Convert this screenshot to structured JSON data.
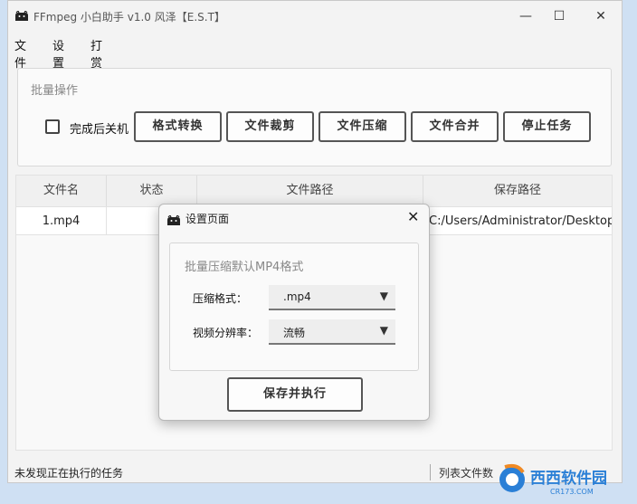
{
  "window": {
    "title": "FFmpeg 小白助手 v1.0 风泽【E.S.T】",
    "minimize": "—",
    "maximize": "☐",
    "close": "✕"
  },
  "menu": [
    "文件",
    "设置",
    "打赏"
  ],
  "batch": {
    "title": "批量操作",
    "shutdown_label": "完成后关机",
    "shutdown_checked": false,
    "buttons": [
      "格式转换",
      "文件裁剪",
      "文件压缩",
      "文件合并",
      "停止任务"
    ]
  },
  "table": {
    "headers": [
      "文件名",
      "状态",
      "文件路径",
      "保存路径"
    ],
    "rows": [
      [
        "1.mp4",
        "",
        "",
        "C:/Users/Administrator/Desktop..."
      ]
    ]
  },
  "status_bar": {
    "left": "未发现正在执行的任务",
    "right": "列表文件数"
  },
  "dialog": {
    "title": "设置页面",
    "close": "✕",
    "section_title": "批量压缩默认MP4格式",
    "fields": [
      {
        "label": "压缩格式：",
        "value": ".mp4"
      },
      {
        "label": "视频分辨率：",
        "value": "流畅"
      }
    ],
    "save_button": "保存并执行"
  },
  "watermark": {
    "text": "西西软件园",
    "subtext": "CR173.COM"
  },
  "colors": {
    "window_bg": "#f3f3f3",
    "desktop_bg": "#cfe0f3",
    "watermark_blue": "#2a7fd6",
    "watermark_orange": "#f08a24"
  }
}
